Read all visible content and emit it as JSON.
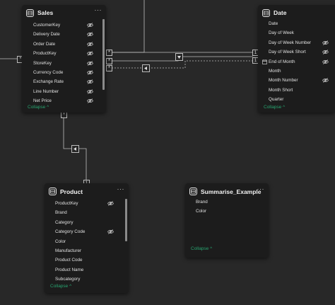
{
  "sales": {
    "title": "Sales",
    "more": "···",
    "fields": [
      {
        "label": "CustomerKey",
        "hidden": true
      },
      {
        "label": "Delivery Date",
        "hidden": true
      },
      {
        "label": "Order Date",
        "hidden": true
      },
      {
        "label": "ProductKey",
        "hidden": true
      },
      {
        "label": "StoreKey",
        "hidden": true
      },
      {
        "label": "Currency Code",
        "hidden": true
      },
      {
        "label": "Exchange Rate",
        "hidden": true
      },
      {
        "label": "Line Number",
        "hidden": true
      },
      {
        "label": "Net Price",
        "hidden": true
      }
    ],
    "collapse": "Collapse ^"
  },
  "date": {
    "title": "Date",
    "more": "···",
    "fields": [
      {
        "label": "Date",
        "hidden": false
      },
      {
        "label": "Day of Week",
        "hidden": false
      },
      {
        "label": "Day of Week Number",
        "hidden": true
      },
      {
        "label": "Day of Week Short",
        "hidden": true
      },
      {
        "label": "End of Month",
        "hidden": true,
        "calendar_icon": true
      },
      {
        "label": "Month",
        "hidden": false
      },
      {
        "label": "Month Number",
        "hidden": true
      },
      {
        "label": "Month Short",
        "hidden": false
      },
      {
        "label": "Quarter",
        "hidden": false
      }
    ],
    "collapse": "Collapse ^"
  },
  "product": {
    "title": "Product",
    "more": "···",
    "fields": [
      {
        "label": "ProductKey",
        "hidden": true
      },
      {
        "label": "Brand",
        "hidden": false
      },
      {
        "label": "Category",
        "hidden": false
      },
      {
        "label": "Category Code",
        "hidden": true
      },
      {
        "label": "Color",
        "hidden": false
      },
      {
        "label": "Manufacturer",
        "hidden": false
      },
      {
        "label": "Product Code",
        "hidden": false
      },
      {
        "label": "Product Name",
        "hidden": false
      },
      {
        "label": "Subcategory",
        "hidden": false
      }
    ],
    "collapse": "Collapse ^"
  },
  "summarise": {
    "title": "Summarise_Example",
    "more": "···",
    "fields": [
      {
        "label": "Brand",
        "hidden": false
      },
      {
        "label": "Color",
        "hidden": false
      }
    ],
    "collapse": "Collapse ^"
  },
  "relationships": {
    "many_symbol": "*",
    "one_symbol": "1"
  },
  "colors": {
    "canvas": "#282828",
    "card": "#1c1c1c",
    "accent": "#27a36f",
    "line": "#bdbdbd"
  },
  "icons": {
    "table": "table-icon",
    "hidden": "eye-hidden-icon",
    "calendar": "calendar-icon",
    "more": "more-options-icon",
    "filter_arrow": "filter-direction-icon"
  }
}
